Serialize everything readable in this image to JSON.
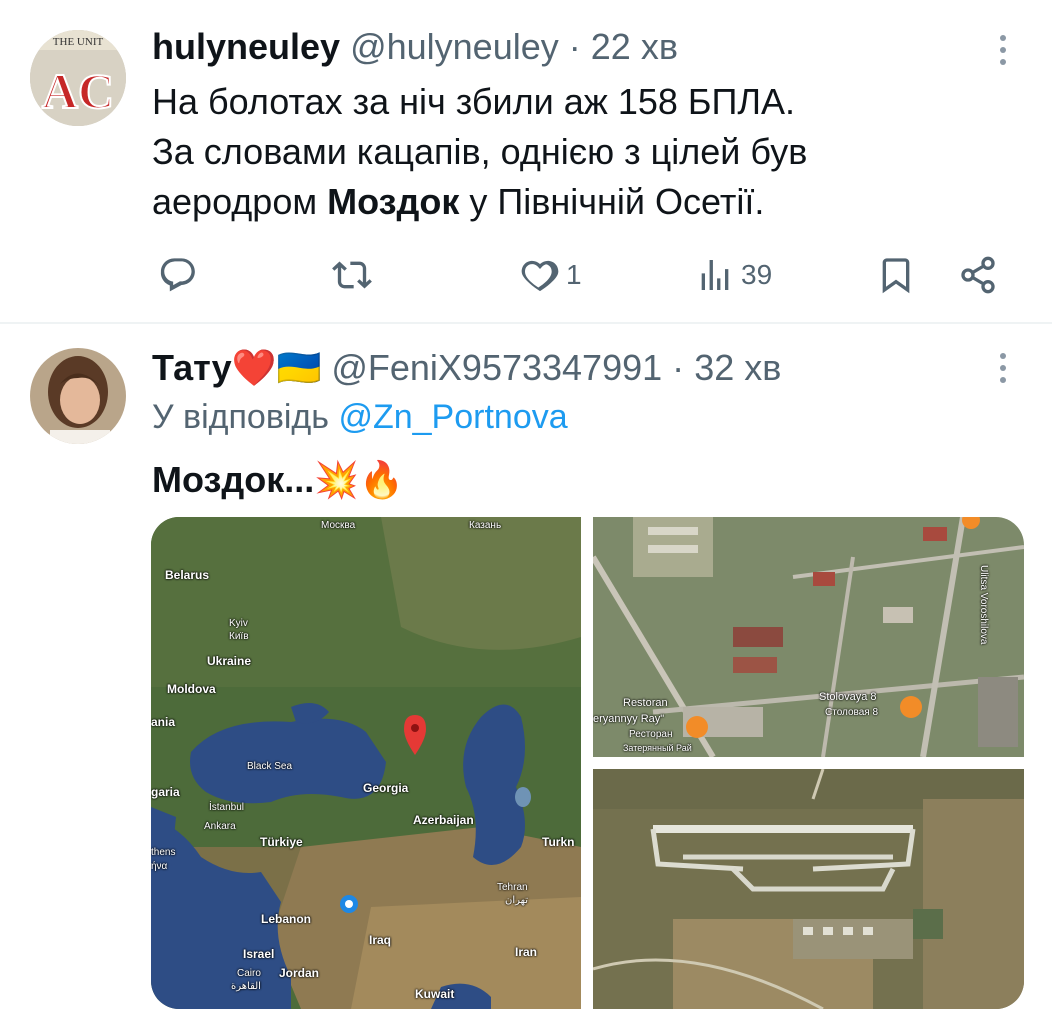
{
  "tweets": [
    {
      "display_name": "hulyneuley",
      "handle": "@hulyneuley",
      "separator": "·",
      "time": "22 хв",
      "lines": [
        {
          "pre": "На болотах за ніч збили  аж 158 БПЛА.",
          "bold": "",
          "post": ""
        },
        {
          "pre": "За словами кацапів, однією з цілей був",
          "bold": "",
          "post": ""
        },
        {
          "pre": "аеродром ",
          "bold": "Моздок",
          "post": " у Північній Осетії."
        }
      ],
      "likes": "1",
      "views": "39",
      "avatar_text": "AC",
      "avatar_banner": "THE UNIT"
    },
    {
      "display_name": "Тату",
      "name_emojis": "❤️🇺🇦",
      "handle": "@FeniX9573347991",
      "separator": "·",
      "time": "32 хв",
      "reply_prefix": "У відповідь",
      "reply_handle": "@Zn_Portnova",
      "text_bold": "Моздок...",
      "text_emojis": "💥🔥"
    }
  ],
  "map_labels": {
    "moscow": "Москва",
    "kazan": "Казань",
    "belarus": "Belarus",
    "kyiv": "Kyiv",
    "kyiv_ua": "Київ",
    "ukraine": "Ukraine",
    "moldova": "Moldova",
    "romania_frag": "ania",
    "black_sea": "Black Sea",
    "georgia": "Georgia",
    "bulgaria_frag": "garia",
    "istanbul": "İstanbul",
    "ankara": "Ankara",
    "turkiye": "Türkiye",
    "athens_frag": "thens",
    "athens_gr_frag": "ήνα",
    "azerbaijan": "Azerbaijan",
    "turkmen_frag": "Turkn",
    "tehran": "Tehran",
    "tehran_fa": "تهران",
    "lebanon": "Lebanon",
    "israel": "Israel",
    "iraq": "Iraq",
    "iran": "Iran",
    "cairo": "Cairo",
    "cairo_ar": "القاهرة",
    "jordan": "Jordan",
    "kuwait": "Kuwait"
  },
  "sat_labels": {
    "restoran_title": "Restoran",
    "restoran_name": "eryannyy Ray\"",
    "restoran_ru": "Ресторан",
    "restoran_ru2": "Затерянный Рай",
    "stolovaya": "Stolovaya 8",
    "stolovaya_ru": "Столовая 8",
    "street": "Ulitsa Voroshilova"
  },
  "colors": {
    "text": "#0f1419",
    "muted": "#536471",
    "link": "#1d9bf0",
    "divider": "#eff3f4",
    "map_pin": "#e53935"
  }
}
